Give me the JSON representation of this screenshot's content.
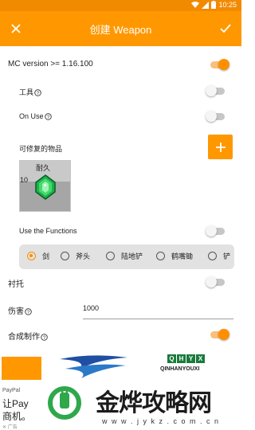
{
  "status_bar": {
    "time": "10:25"
  },
  "app_bar": {
    "title": "创建 Weapon",
    "close_icon": "close-icon",
    "confirm_icon": "check-icon"
  },
  "settings": {
    "mc_version": {
      "label": "MC version >= 1.16.100",
      "on": true
    },
    "tool": {
      "label": "工具",
      "on": false
    },
    "on_use": {
      "label": "On Use",
      "on": false
    },
    "repair_items": {
      "label": "可修复的物品",
      "add_icon": "plus-icon"
    },
    "item": {
      "durability_label": "耐久",
      "durability_value": "10",
      "icon": "emerald-icon"
    },
    "use_functions": {
      "label": "Use the Functions",
      "on": false
    },
    "function_options": [
      "剑",
      "斧头",
      "陆地铲",
      "鹤嘴锄",
      "铲"
    ],
    "selected_option": "剑",
    "hand_equipped": {
      "label": "衬托",
      "on": false
    },
    "damage": {
      "label": "伤害",
      "value": "1000"
    },
    "craftable": {
      "label": "合成制作",
      "on": true
    }
  },
  "ad": {
    "paypal_small": "PayPal",
    "paypal_line1": "让Pay",
    "paypal_line2": "商机。",
    "ad_tag": "✕ 广告",
    "brand_letters": [
      "Q",
      "H",
      "Y",
      "X"
    ],
    "brand_sub": "QINHANYOUXI",
    "brand_name": "金烨攻略网",
    "brand_url": "w w w . j y k z . c o m . c n"
  },
  "colors": {
    "accent": "#ff9800",
    "status_bar": "#f28a00"
  }
}
